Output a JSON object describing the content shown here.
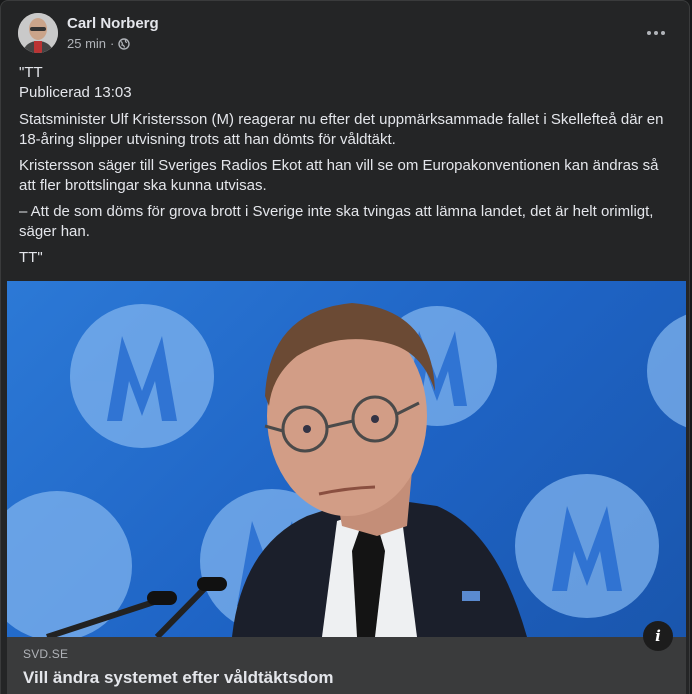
{
  "post": {
    "author": "Carl Norberg",
    "time": "25 min",
    "separator": "·",
    "audience_icon": "globe-icon",
    "paragraphs": [
      "\"TT",
      "Publicerad 13:03",
      "Statsminister Ulf Kristersson (M) reagerar nu efter det uppmärksammade fallet i Skellefteå där en 18-åring slipper utvisning trots att han dömts för våldtäkt.",
      "Kristersson säger till Sveriges Radios Ekot att han vill se om Europakonventionen kan ändras så att fler brottslingar ska kunna utvisas.",
      "– Att de som döms för grova brott i Sverige inte ska tvingas att lämna landet, det är helt orimligt, säger han.",
      "TT\""
    ]
  },
  "link_preview": {
    "domain": "SVD.SE",
    "title": "Vill ändra systemet efter våldtäktsdom",
    "info_label": "i"
  },
  "colors": {
    "card_bg": "#242526",
    "text": "#e4e6eb",
    "muted": "#b0b3b8",
    "image_bg": "#1e63c4"
  }
}
